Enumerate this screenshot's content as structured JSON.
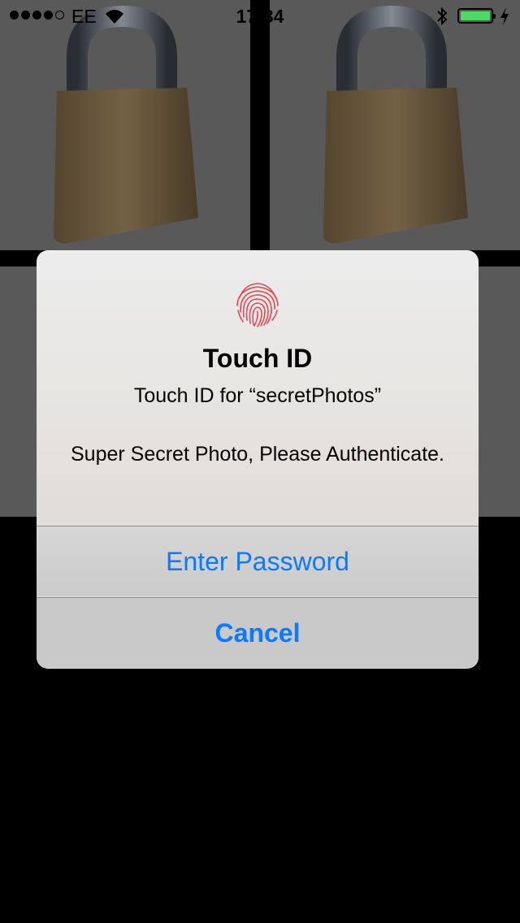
{
  "status_bar": {
    "carrier": "EE",
    "time": "17:34",
    "signal_bars_filled": 4,
    "signal_bars_total": 5,
    "battery_level": 1.0,
    "battery_color": "#4cd964"
  },
  "gallery": {
    "tiles": [
      "padlock-photo",
      "padlock-photo",
      "grey-photo",
      "grey-photo"
    ]
  },
  "alert": {
    "icon": "fingerprint-icon",
    "icon_color": "#e8474e",
    "title": "Touch ID",
    "subtitle": "Touch ID for “secretPhotos”",
    "message": "Super Secret Photo, Please Authenticate.",
    "buttons": {
      "enter_password": "Enter Password",
      "cancel": "Cancel"
    },
    "button_color": "#0a7aff"
  }
}
